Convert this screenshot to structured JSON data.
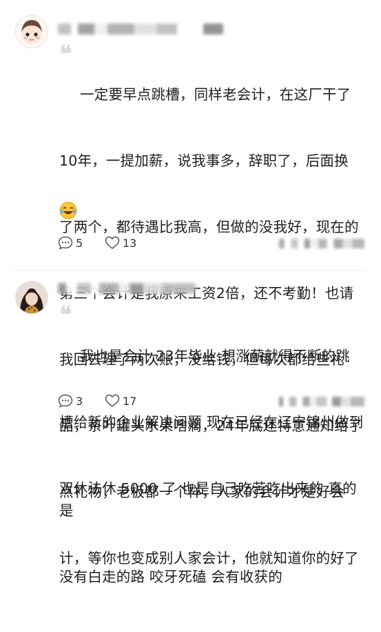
{
  "comments": [
    {
      "text": "一定要早点跳槽，同样老会计，在这厂干了10年，一提加薪，说我事多，辞职了，后面换了两个，都待遇比我高，但做的没我好，现在的第三个会计是我原来工资2倍，还不考勤！也请我回去理了两次账，没给钱，但每次都给些礼品，茶叶罐头水果啥滴，24年底还特意通知给了点礼物，老板都一个样，人家的会计才是好会计，等你也变成别人家会计，他就知道你的好了",
      "lines": [
        "一定要早点跳槽，同样老会计，在这厂干了",
        "10年，一提加薪，说我事多，辞职了，后面换",
        "了两个，都待遇比我高，但做的没我好，现在的",
        "第三个会计是我原来工资2倍，还不考勤！也请",
        "我回去理了两次账，没给钱，但每次都给些礼",
        "品，茶叶罐头水果啥滴，24年底还特意通知给了",
        "点礼物，老板都一个样，人家的会计才是好会",
        "计，等你也变成别人家会计，他就知道你的好了"
      ],
      "emoji": "crying-laughing-emoji",
      "reply_count": "5",
      "like_count": "13"
    },
    {
      "lines": [
        "我也是会计 23年毕业 想涨薪就得不断的跳",
        "槽给新的企业解决问题 现在已经在辽宁锦州做到",
        "双休法休 5000 了 也是自己吃苦吃出来的 真的是",
        "没有白走的路 咬牙死磕 会有收获的"
      ],
      "reply_count": "3",
      "like_count": "17"
    }
  ],
  "icons": {
    "reply": "comment-bubble-icon",
    "like": "heart-icon"
  },
  "colors": {
    "text": "#1f1f1f",
    "muted": "#333333",
    "quote": "#dcdcdc"
  }
}
